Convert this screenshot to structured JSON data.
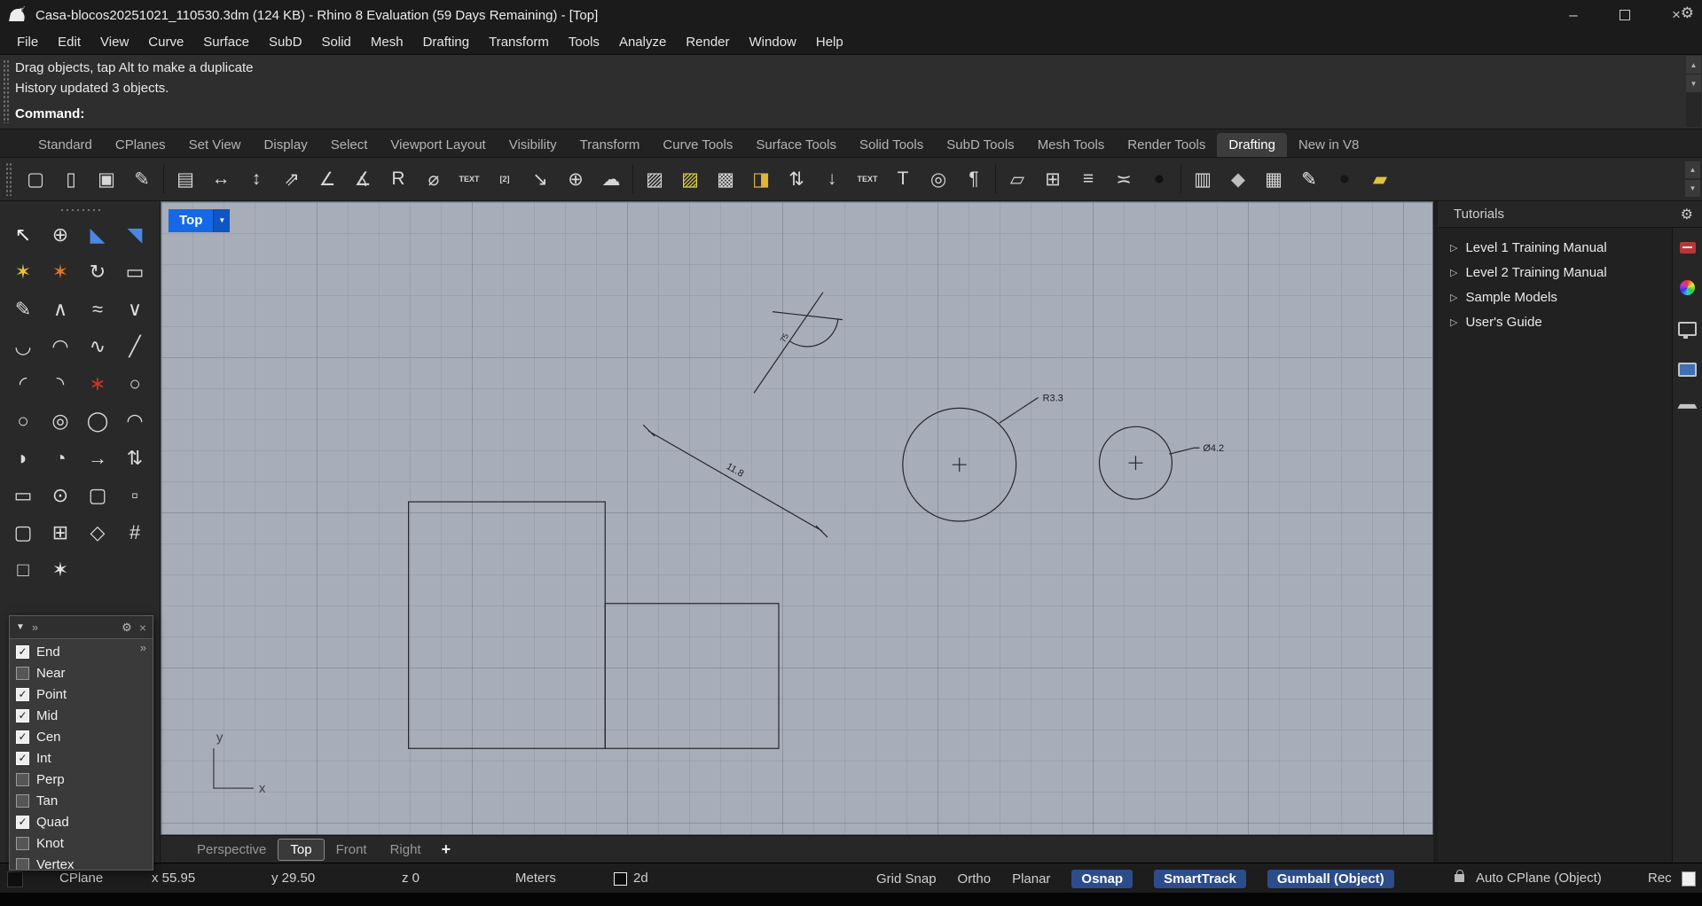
{
  "title_bar": {
    "title": "Casa-blocos20251021_110530.3dm (124 KB) - Rhino 8 Evaluation (59 Days Remaining) - [Top]"
  },
  "icons": {
    "minimize": "–",
    "close": "×",
    "gear": "⚙",
    "dropdown": "▼",
    "scroll_up": "▲",
    "scroll_down": "▼",
    "chevrons": "»",
    "funnel": "▼",
    "panel_close": "×",
    "expand_arrow": "▷",
    "check": "✓"
  },
  "menu": {
    "items": [
      "File",
      "Edit",
      "View",
      "Curve",
      "Surface",
      "SubD",
      "Solid",
      "Mesh",
      "Drafting",
      "Transform",
      "Tools",
      "Analyze",
      "Render",
      "Window",
      "Help"
    ]
  },
  "command_area": {
    "history": [
      "Drag objects, tap Alt to make a duplicate",
      "History updated 3 objects."
    ],
    "prompt_label": "Command:"
  },
  "toolbar": {
    "tabs": [
      {
        "label": "Standard"
      },
      {
        "label": "CPlanes"
      },
      {
        "label": "Set View"
      },
      {
        "label": "Display"
      },
      {
        "label": "Select"
      },
      {
        "label": "Viewport Layout"
      },
      {
        "label": "Visibility"
      },
      {
        "label": "Transform"
      },
      {
        "label": "Curve Tools"
      },
      {
        "label": "Surface Tools"
      },
      {
        "label": "Solid Tools"
      },
      {
        "label": "SubD Tools"
      },
      {
        "label": "Mesh Tools"
      },
      {
        "label": "Render Tools"
      },
      {
        "label": "Drafting",
        "active": true
      },
      {
        "label": "New in V8"
      }
    ],
    "icons": [
      {
        "name": "new-file",
        "glyph": "▢"
      },
      {
        "name": "open-file",
        "glyph": "▯"
      },
      {
        "name": "save-file",
        "glyph": "▣"
      },
      {
        "name": "edit-template",
        "glyph": "✎"
      },
      {
        "sep": true
      },
      {
        "name": "notes",
        "glyph": "▤"
      },
      {
        "name": "dim-linear",
        "glyph": "↔"
      },
      {
        "name": "dim-vertical",
        "glyph": "↕"
      },
      {
        "name": "dim-aligned",
        "glyph": "⇗"
      },
      {
        "name": "dim-rotated",
        "glyph": "∠"
      },
      {
        "name": "dim-angle",
        "glyph": "∡"
      },
      {
        "name": "dim-radius",
        "glyph": "R"
      },
      {
        "name": "dim-diameter",
        "glyph": "⌀"
      },
      {
        "name": "text-block",
        "glyph": "TEXT",
        "small": true
      },
      {
        "name": "text-numbered",
        "glyph": "[2]",
        "small": true
      },
      {
        "name": "leader",
        "glyph": "↘"
      },
      {
        "name": "point-dot",
        "glyph": "⊕"
      },
      {
        "name": "revision-cloud",
        "glyph": "☁"
      },
      {
        "sep": true
      },
      {
        "name": "hatch",
        "glyph": "▨"
      },
      {
        "name": "hatch-yellow",
        "glyph": "▨",
        "color": "#ddd04a"
      },
      {
        "name": "hatch-solid",
        "glyph": "▩"
      },
      {
        "name": "match-properties",
        "glyph": "◨",
        "color": "#e0b53a"
      },
      {
        "name": "dim-recenter-text",
        "glyph": "⇅"
      },
      {
        "name": "dim-evaluate",
        "glyph": "↓"
      },
      {
        "name": "text-edit",
        "glyph": "TEXT",
        "small": true
      },
      {
        "name": "text-height",
        "glyph": "T"
      },
      {
        "name": "text-find",
        "glyph": "◎"
      },
      {
        "name": "annotation-styles",
        "glyph": "¶"
      },
      {
        "sep": true
      },
      {
        "name": "detail-view",
        "glyph": "▱"
      },
      {
        "name": "layout-table",
        "glyph": "⊞"
      },
      {
        "name": "layout-list",
        "glyph": "≡"
      },
      {
        "name": "align-spacing",
        "glyph": "≍"
      },
      {
        "name": "render-sphere",
        "glyph": "●",
        "color": "#111111"
      },
      {
        "sep": true
      },
      {
        "name": "print-layout",
        "glyph": "▥"
      },
      {
        "name": "model-box",
        "glyph": "◆",
        "color": "#bdbdbd"
      },
      {
        "name": "duplicate-sheet",
        "glyph": "▦"
      },
      {
        "name": "drafting-pen",
        "glyph": "✎",
        "color": "#ececec"
      },
      {
        "name": "text-sphere",
        "glyph": "●",
        "color": "#161616"
      },
      {
        "name": "folder-open-yellow",
        "glyph": "▰",
        "color": "#e3c23d"
      }
    ]
  },
  "sidebar": {
    "icons": [
      {
        "name": "select-pointer",
        "glyph": "↖",
        "color": "#f2f2f2"
      },
      {
        "name": "select-brush",
        "glyph": "⊕"
      },
      {
        "name": "cplane-set",
        "glyph": "◣",
        "color": "#4a86e8"
      },
      {
        "name": "cplane-world",
        "glyph": "◥",
        "color": "#4a86e8"
      },
      {
        "name": "osnap-burst",
        "glyph": "✶",
        "color": "#e8c33a"
      },
      {
        "name": "smarttrack",
        "glyph": "✶",
        "color": "#e07820"
      },
      {
        "name": "record-history",
        "glyph": "↻"
      },
      {
        "name": "named-views",
        "glyph": "▭"
      },
      {
        "name": "curve-freeform",
        "glyph": "✎"
      },
      {
        "name": "polyline",
        "glyph": "∧"
      },
      {
        "name": "curve-interpolate",
        "glyph": "≈"
      },
      {
        "name": "curve-v",
        "glyph": "∨"
      },
      {
        "name": "curve-handle",
        "glyph": "◡"
      },
      {
        "name": "arc-start",
        "glyph": "◠"
      },
      {
        "name": "curve-sketch",
        "glyph": "∿"
      },
      {
        "name": "line-single",
        "glyph": "╱"
      },
      {
        "name": "curve-blend",
        "glyph": "◜"
      },
      {
        "name": "curve-extend",
        "glyph": "◝"
      },
      {
        "name": "curve-through-points",
        "glyph": "∗",
        "color": "#cc3322"
      },
      {
        "name": "circle-tangent",
        "glyph": "○"
      },
      {
        "name": "circle-center",
        "glyph": "○"
      },
      {
        "name": "circle-3pt",
        "glyph": "◎"
      },
      {
        "name": "ellipse",
        "glyph": "◯"
      },
      {
        "name": "arc-center",
        "glyph": "◠"
      },
      {
        "name": "arc-3pt",
        "glyph": "◗"
      },
      {
        "name": "arc-tangent",
        "glyph": "◔"
      },
      {
        "name": "curve-offset",
        "glyph": "→"
      },
      {
        "name": "point-updown",
        "glyph": "⇅"
      },
      {
        "name": "rect-3pt",
        "glyph": "▭"
      },
      {
        "name": "torus",
        "glyph": "⊙"
      },
      {
        "name": "rectangle-rounded",
        "glyph": "▢"
      },
      {
        "name": "rect-dashed",
        "glyph": "▫"
      },
      {
        "name": "rounded-rect",
        "glyph": "▢"
      },
      {
        "name": "polygon-grid",
        "glyph": "⊞"
      },
      {
        "name": "polygon",
        "glyph": "◇"
      },
      {
        "name": "rect-corner-pts",
        "glyph": "#"
      },
      {
        "name": "square-center",
        "glyph": "□"
      },
      {
        "name": "star",
        "glyph": "✶",
        "color": "#e0e0e0"
      }
    ]
  },
  "osnap_panel": {
    "items": [
      {
        "label": "End",
        "checked": true
      },
      {
        "label": "Near",
        "checked": false
      },
      {
        "label": "Point",
        "checked": true
      },
      {
        "label": "Mid",
        "checked": true
      },
      {
        "label": "Cen",
        "checked": true
      },
      {
        "label": "Int",
        "checked": true
      },
      {
        "label": "Perp",
        "checked": false
      },
      {
        "label": "Tan",
        "checked": false
      },
      {
        "label": "Quad",
        "checked": true
      },
      {
        "label": "Knot",
        "checked": false
      },
      {
        "label": "Vertex",
        "checked": false
      }
    ]
  },
  "viewport": {
    "title": "Top",
    "axis": {
      "x": "x",
      "y": "y"
    },
    "annotations": {
      "radius": "R3.3",
      "diameter": "Ø4.2",
      "length": "11.8",
      "angle": "75"
    },
    "tabs": [
      {
        "label": "Perspective"
      },
      {
        "label": "Top",
        "active": true
      },
      {
        "label": "Front"
      },
      {
        "label": "Right"
      }
    ],
    "add_tab": "+"
  },
  "tutorials": {
    "title": "Tutorials",
    "items": [
      "Level 1 Training Manual",
      "Level 2 Training Manual",
      "Sample Models",
      "User's Guide"
    ]
  },
  "status_bar": {
    "cplane": "CPlane",
    "x": "x 55.95",
    "y": "y 29.50",
    "z": "z 0",
    "units": "Meters",
    "layer": "2d",
    "toggles": [
      {
        "label": "Grid Snap"
      },
      {
        "label": "Ortho"
      },
      {
        "label": "Planar"
      },
      {
        "label": "Osnap",
        "active": true
      },
      {
        "label": "SmartTrack",
        "active": true
      },
      {
        "label": "Gumball (Object)",
        "active": true
      }
    ],
    "auto_cplane": "Auto CPlane (Object)",
    "record": "Rec"
  }
}
